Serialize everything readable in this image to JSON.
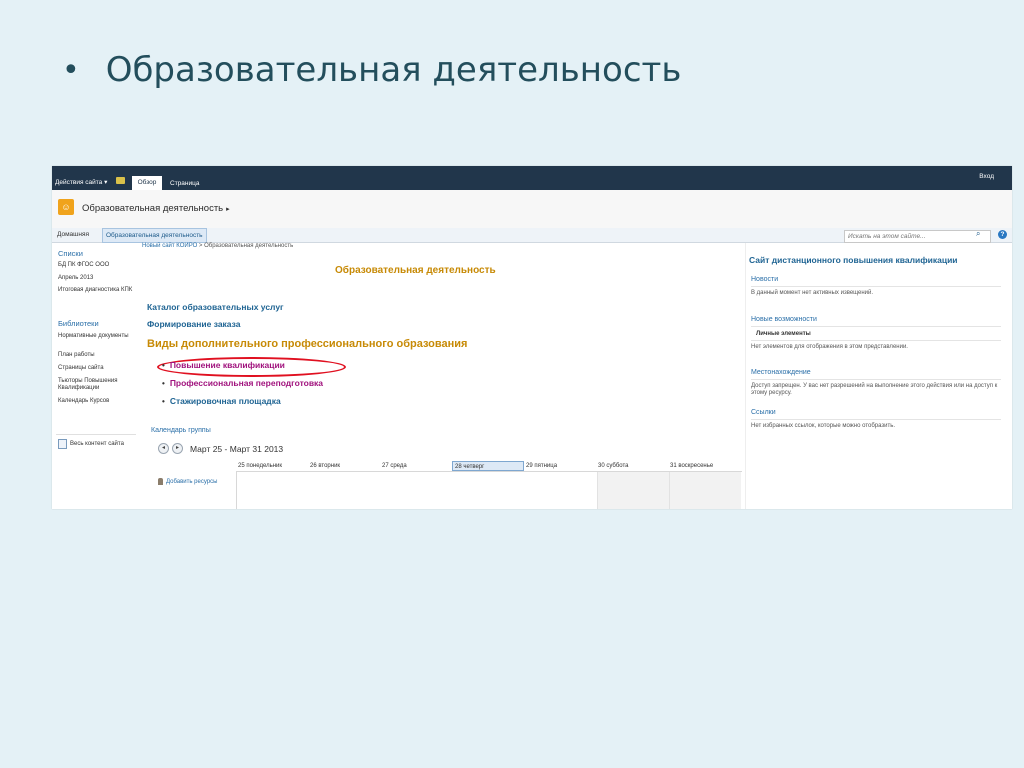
{
  "slide": {
    "bullet": "•",
    "title": "Образовательная деятельность"
  },
  "ribbon": {
    "site_actions": "Действия сайта ▾",
    "tab_view": "Обзор",
    "tab_page": "Страница",
    "login": "Вход"
  },
  "site": {
    "title": "Образовательная деятельность",
    "arrow": "▸"
  },
  "topnav": {
    "home": "Домашняя",
    "current": "Образовательная деятельность",
    "search_placeholder": "Искать на этом сайте..."
  },
  "leftnav": {
    "lists_head": "Списки",
    "lists": [
      "БД ПК ФГОС ООО",
      "Апрель 2013",
      "Итоговая диагностика КПК"
    ],
    "libraries_head": "Библиотеки",
    "libraries": [
      "Нормативные документы",
      "План работы",
      "Страницы сайта",
      "Тьюторы Повышения Квалификации",
      "Календарь Курсов"
    ],
    "all_content": "Весь контент сайта"
  },
  "main": {
    "breadcrumb_root": "Новый сайт КОИРО",
    "breadcrumb_sep": ">",
    "breadcrumb_current": "Образовательная деятельность",
    "heading": "Образовательная деятельность",
    "catalog_link": "Каталог образовательных услуг",
    "order_link": "Формирование заказа",
    "kinds_heading": "Виды дополнительного профессионального образования",
    "kinds": [
      "Повышение квалификации",
      "Профессиональная переподготовка",
      "Стажировочная площадка"
    ],
    "calendar_title": "Календарь группы",
    "calendar_range": "Март 25 - Март 31 2013",
    "calendar_prev": "◂",
    "calendar_next": "▸",
    "calendar_days": [
      "25 понедельник",
      "26 вторник",
      "27 среда",
      "28 четверг",
      "29 пятница",
      "30 суббота",
      "31 воскресенье"
    ],
    "add_resources": "Добавить ресурсы"
  },
  "right": {
    "heading": "Сайт дистанционного повышения квалификации",
    "news_head": "Новости",
    "news_text": "В данный момент нет активных извещений.",
    "features_head": "Новые возможности",
    "personal_items": "Личные элементы",
    "features_text": "Нет элементов для отображения в этом представлении.",
    "location_head": "Местонахождение",
    "location_text": "Доступ запрещен. У вас нет разрешений на выполнение этого действия или на доступ к этому ресурсу.",
    "links_head": "Ссылки",
    "links_text": "Нет избранных ссылок, которые можно отобразить."
  },
  "colors": {
    "accent_orange": "#c78a06",
    "link_blue": "#1f6493",
    "ribbon": "#21364b",
    "highlight_red": "#e01020"
  }
}
